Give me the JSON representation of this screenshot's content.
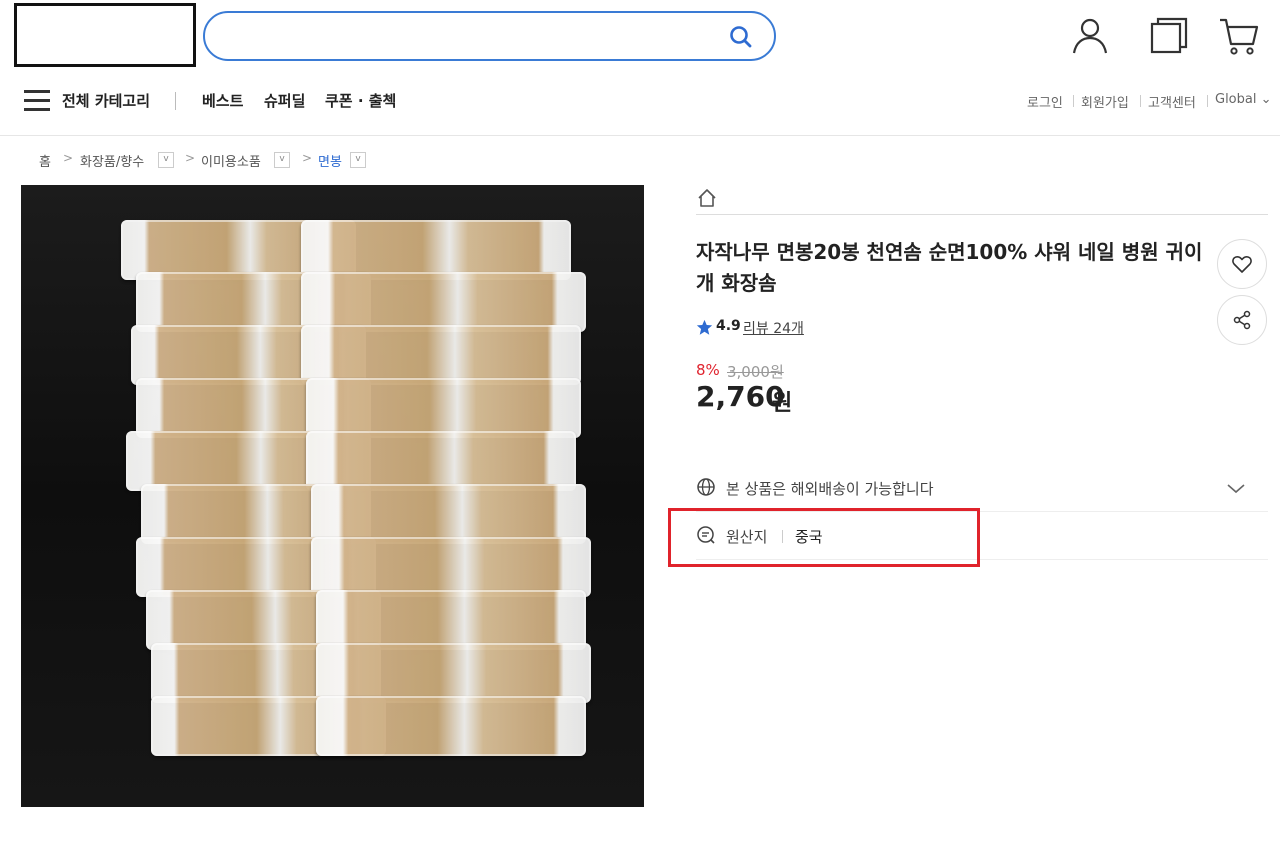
{
  "header": {
    "search": {
      "value": "",
      "placeholder": ""
    }
  },
  "nav": {
    "all_categories": "전체 카테고리",
    "links": [
      "베스트",
      "슈퍼딜",
      "쿠폰 · 출첵"
    ],
    "utility": [
      "로그인",
      "회원가입",
      "고객센터",
      "Global ⌄"
    ]
  },
  "breadcrumb": [
    "홈",
    "화장품/향수",
    "이미용소품",
    "면봉"
  ],
  "product": {
    "title": "자작나무 면봉20봉 천연솜 순면100% 샤워 네일 병원 귀이개 화장솜",
    "rating": "4.9",
    "review_label": "리뷰 24개",
    "discount": "8%",
    "original_price": "3,000원",
    "price": "2,760",
    "price_unit": "원",
    "shipping_notice": "본 상품은 해외배송이 가능합니다",
    "origin_label": "원산지",
    "origin_value": "중국"
  },
  "colors": {
    "accent_blue": "#3a7bd5",
    "discount_red": "#e0242f",
    "highlight_red": "#e0232b",
    "star_blue": "#2e6bd1"
  }
}
